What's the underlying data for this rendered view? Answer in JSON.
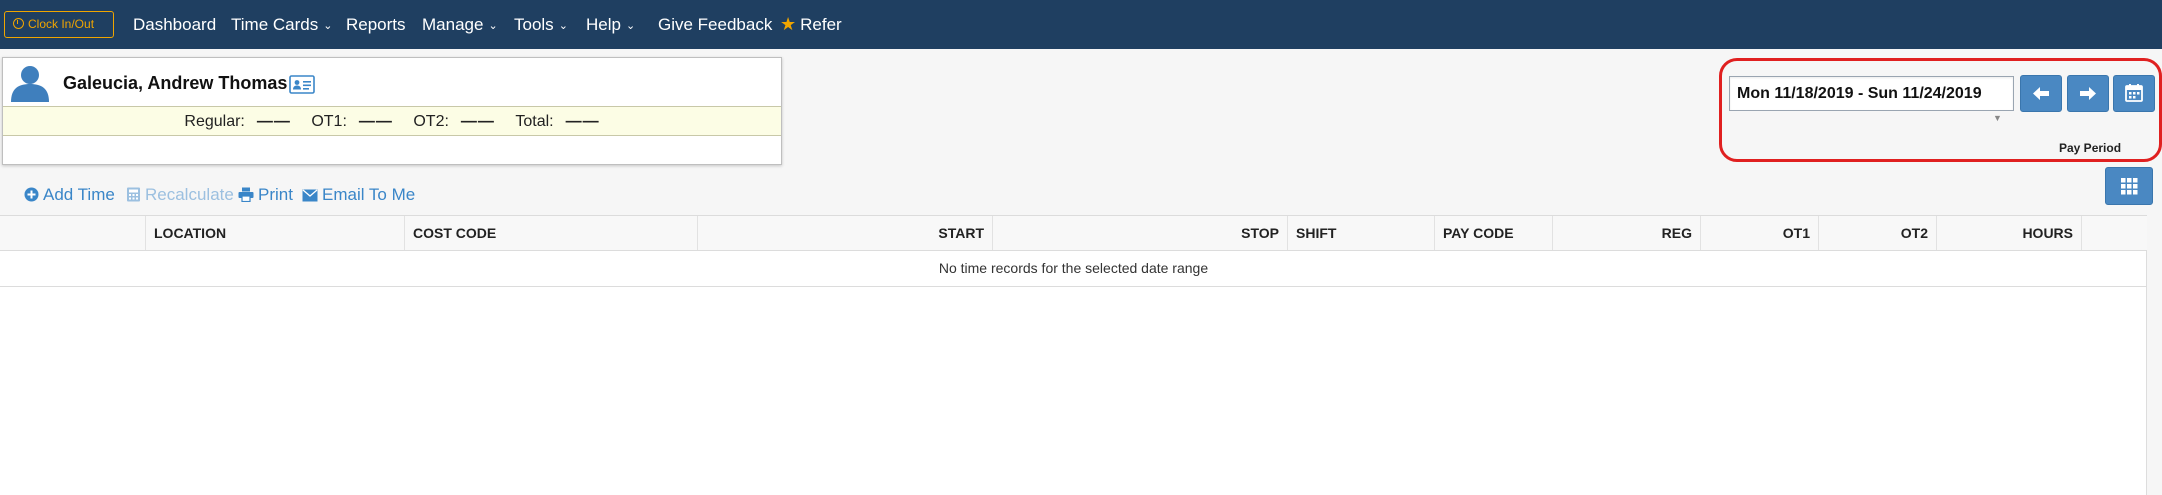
{
  "nav": {
    "clock_label": "Clock In/Out",
    "items": [
      {
        "label": "Dashboard"
      },
      {
        "label": "Time Cards"
      },
      {
        "label": "Reports"
      },
      {
        "label": "Manage"
      },
      {
        "label": "Tools"
      },
      {
        "label": "Help"
      },
      {
        "label": "Give Feedback"
      },
      {
        "label": "Refer"
      }
    ]
  },
  "employee": {
    "name": "Galeucia, Andrew Thomas",
    "totals": {
      "regular_label": "Regular:",
      "regular_value": "——",
      "ot1_label": "OT1:",
      "ot1_value": "——",
      "ot2_label": "OT2:",
      "ot2_value": "——",
      "total_label": "Total:",
      "total_value": "——"
    }
  },
  "pay_period": {
    "value": "Mon 11/18/2019 - Sun 11/24/2019",
    "label": "Pay Period"
  },
  "toolbar": {
    "add_time": "Add Time",
    "recalculate": "Recalculate",
    "print": "Print",
    "email": "Email To Me"
  },
  "table": {
    "columns": [
      "LOCATION",
      "COST CODE",
      "START",
      "STOP",
      "SHIFT",
      "PAY CODE",
      "REG",
      "OT1",
      "OT2",
      "HOURS"
    ],
    "empty_message": "No time records for the selected date range"
  },
  "colors": {
    "navbar": "#1f3f61",
    "accent": "#f0a500",
    "button": "#4a88c2",
    "link": "#3a86c8",
    "highlight": "#e02020",
    "totals_bg": "#fcfde5"
  }
}
